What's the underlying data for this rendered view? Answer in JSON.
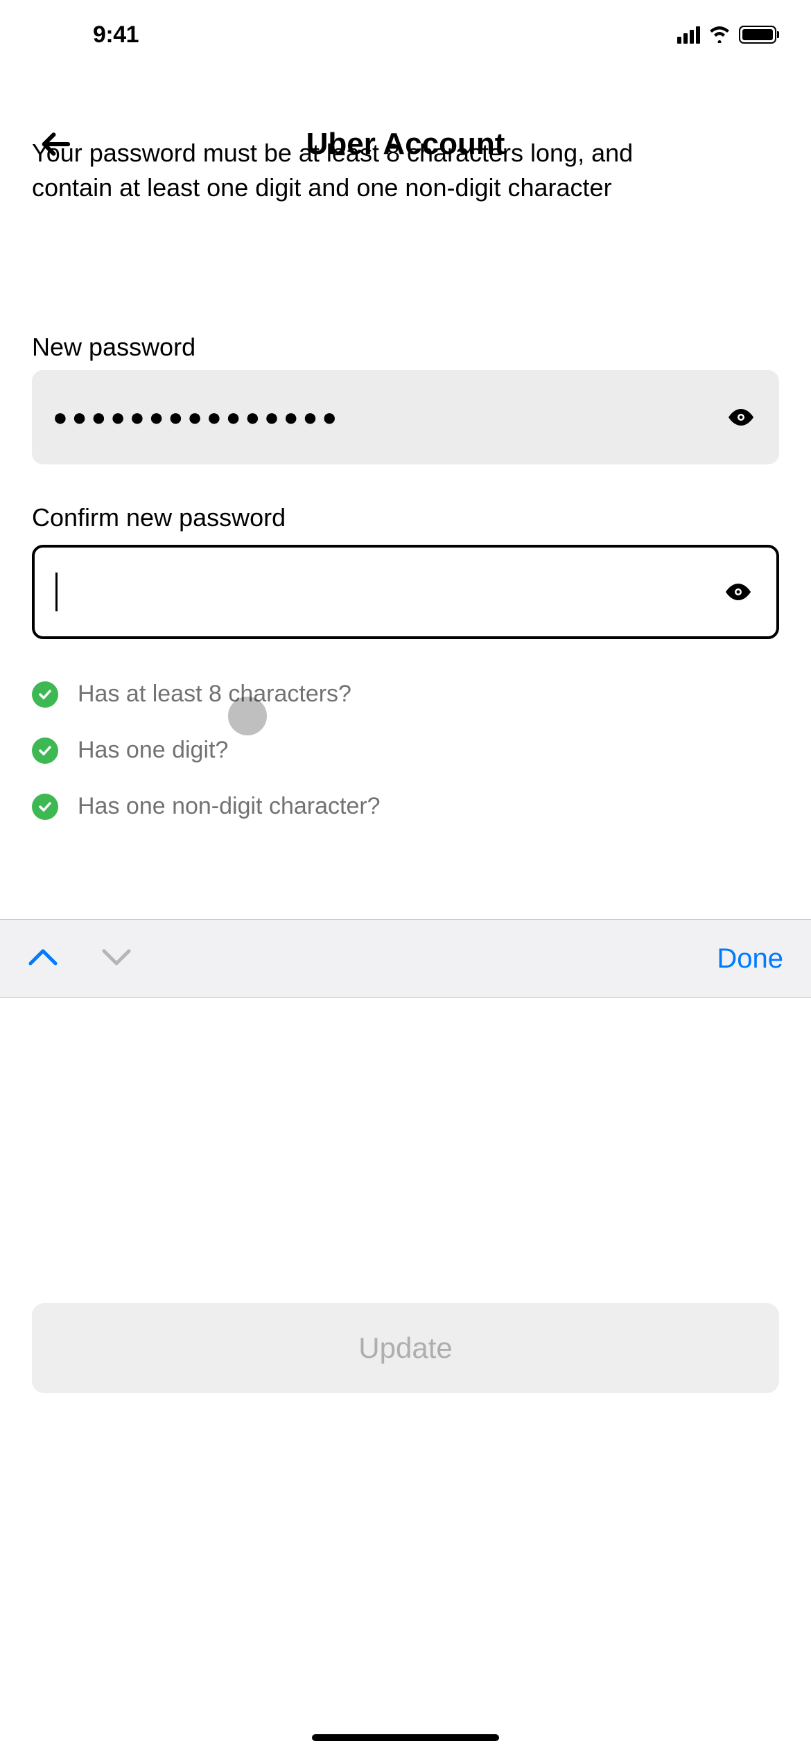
{
  "status": {
    "time": "9:41"
  },
  "header": {
    "title": "Uber Account"
  },
  "instructions": {
    "cutoff_line": "Your password must be at least 8 characters long, and",
    "visible_line": "contain at least one digit and one non-digit character"
  },
  "fields": {
    "new_password": {
      "label": "New password",
      "masked_value": "●●●●●●●●●●●●●●●"
    },
    "confirm_password": {
      "label": "Confirm new password",
      "value": ""
    }
  },
  "requirements": [
    {
      "text": "Has at least 8 characters?",
      "met": true
    },
    {
      "text": "Has one digit?",
      "met": true
    },
    {
      "text": "Has one non-digit character?",
      "met": true
    }
  ],
  "keyboard_bar": {
    "done": "Done"
  },
  "actions": {
    "update": "Update"
  },
  "colors": {
    "success": "#3db853",
    "link": "#007aff"
  }
}
